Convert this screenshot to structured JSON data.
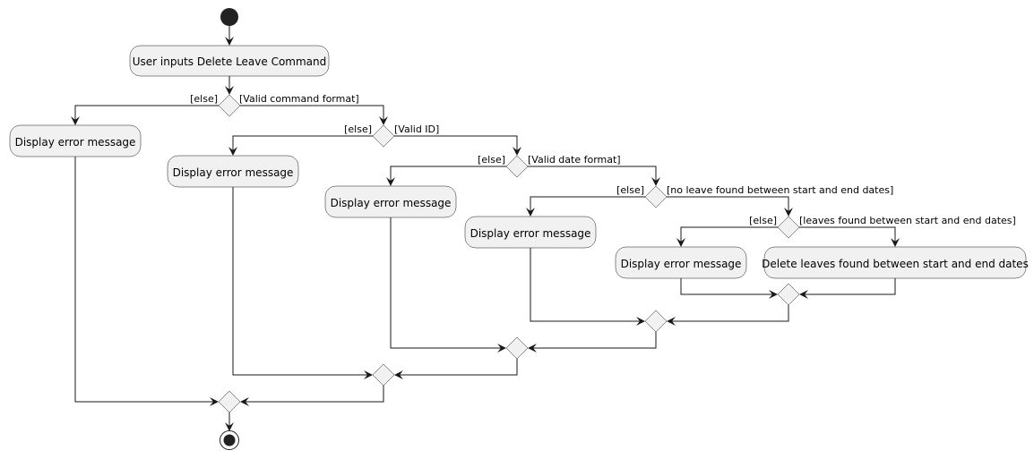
{
  "diagram": {
    "type": "activity",
    "colors": {
      "node_fill": "#f1f1f1",
      "line": "#181818",
      "start_end": "#222222",
      "background": "#ffffff"
    },
    "start": {
      "label": "start"
    },
    "end": {
      "label": "stop"
    },
    "activities": [
      {
        "id": "a0",
        "label": "User inputs Delete Leave Command"
      },
      {
        "id": "a1",
        "label": "Display error message"
      },
      {
        "id": "a2",
        "label": "Display error message"
      },
      {
        "id": "a3",
        "label": "Display error message"
      },
      {
        "id": "a4",
        "label": "Display error message"
      },
      {
        "id": "a5",
        "label": "Display error message"
      },
      {
        "id": "a6",
        "label": "Delete leaves found between start and end dates"
      }
    ],
    "decisions": [
      {
        "id": "d1",
        "else": "[else]",
        "yes": "[Valid command format]"
      },
      {
        "id": "d2",
        "else": "[else]",
        "yes": "[Valid ID]"
      },
      {
        "id": "d3",
        "else": "[else]",
        "yes": "[Valid date format]"
      },
      {
        "id": "d4",
        "else": "[else]",
        "yes": "[no leave found between start and end dates]"
      },
      {
        "id": "d5",
        "else": "[else]",
        "yes": "[leaves found between start and end dates]"
      }
    ]
  }
}
